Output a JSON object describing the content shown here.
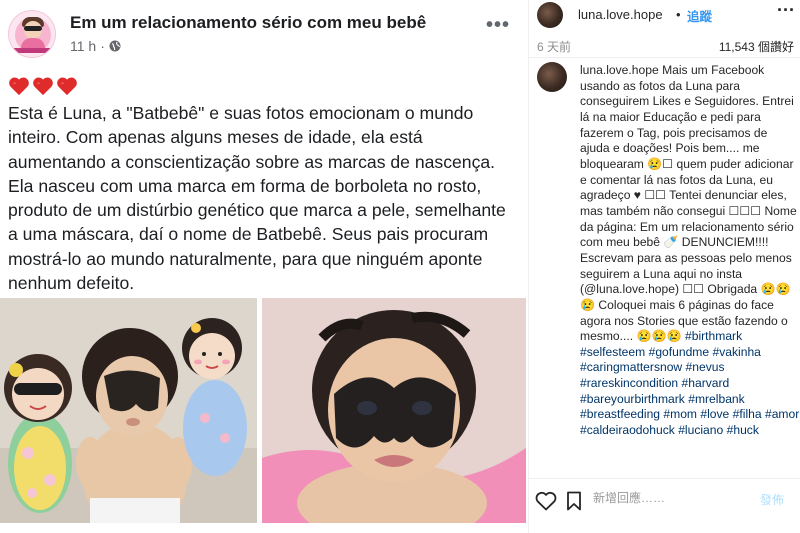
{
  "facebook": {
    "page_name": "Em um relacionamento sério com meu bebê",
    "time": "11 h",
    "dot": "·",
    "more_label": "•••",
    "hearts": [
      "heart",
      "heart",
      "heart"
    ],
    "paragraph": "Esta é Luna, a \"Batbebê\" e suas fotos emocionam o mundo inteiro. Com apenas alguns meses de idade, ela está aumentando a conscientização sobre as marcas de nascença. Ela nasceu com uma marca em forma de borboleta no rosto, produto de um distúrbio genético que marca a pele, semelhante a uma máscara, daí o nome de Batbebê. Seus pais procuram mostrá-lo ao mundo naturalmente, para que ninguém aponte nenhum defeito.",
    "icons": {
      "globe": "globe-icon",
      "heart": "heart-icon",
      "more": "more-icon"
    }
  },
  "instagram": {
    "username": "luna.love.hope",
    "dot": "•",
    "follow_label": "追蹤",
    "more_label": "···",
    "time": "6 天前",
    "likes": "11,543 個讚好",
    "caption_user": "luna.love.hope",
    "caption_text": "Mais um Facebook usando as fotos da Luna para conseguirem Likes e Seguidores. Entrei lá na maior Educação e pedi para fazerem o Tag, pois precisamos de ajuda e doações! Pois bem.... me bloquearam 😢☐ quem puder adicionar e comentar lá nas fotos da Luna, eu agradeço ♥ ☐☐ Tentei denunciar eles, mas também não consegui ☐☐☐ Nome da página: Em um relacionamento sério com meu bebê 🍼 DENUNCIEM!!!! Escrevam para as pessoas pelo menos seguirem a Luna aqui no insta (@luna.love.hope) ☐☐ Obrigada 😢😢😢 Coloquei mais 6 páginas do face agora nos Stories que estão fazendo o mesmo.... 😢😢😢",
    "hashtags": [
      "#birthmark",
      "#selfesteem",
      "#gofundme",
      "#vakinha",
      "#caringmattersnow",
      "#nevus",
      "#rareskincondition",
      "#harvard",
      "#bareyourbirthmark",
      "#mrelbank",
      "#breastfeeding",
      "#mom",
      "#love",
      "#filha",
      "#amor",
      "#caldeiraodohuck",
      "#luciano",
      "#huck"
    ],
    "comment_placeholder": "新增回應……",
    "post_label": "發佈",
    "icons": {
      "like": "heart-outline-icon",
      "save": "bookmark-icon",
      "more": "more-icon"
    }
  },
  "colors": {
    "link": "#003569",
    "follow": "#3897f0",
    "post_disabled": "#b2dffc",
    "heart": "#e02b2b",
    "fb_text": "#1c1e21",
    "fb_meta": "#65676b"
  }
}
